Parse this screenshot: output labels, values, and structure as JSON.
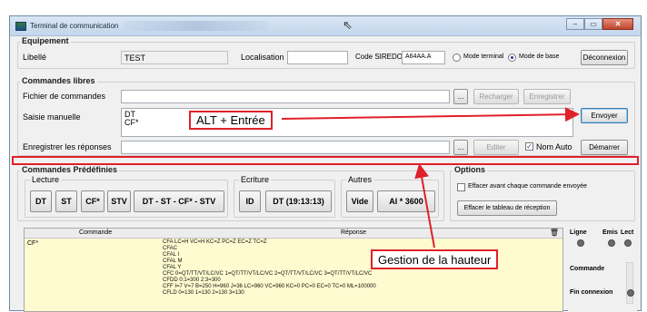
{
  "window": {
    "title": "Terminal de communication",
    "minimize": "–",
    "maximize": "▭",
    "close": "✕"
  },
  "equipement": {
    "title": "Equipement",
    "libelle_label": "Libellé",
    "libelle_value": "TEST",
    "localisation_label": "Localisation",
    "localisation_value": "",
    "code_label": "Code SIREDO",
    "code_value": "A64AA.A",
    "mode_terminal": "Mode terminal",
    "mode_base": "Mode de base",
    "selected_mode": "Mode de base",
    "deconnexion": "Déconnexion"
  },
  "commandes_libres": {
    "title": "Commandes libres",
    "fichier_label": "Fichier de commandes",
    "fichier_value": "",
    "browse": "...",
    "recharger": "Recharger",
    "enregistrer": "Enregistrer",
    "saisie_label": "Saisie manuelle",
    "saisie_line1": "DT",
    "saisie_line2": "CF*",
    "envoyer": "Envoyer",
    "reponses_label": "Enregistrer les réponses",
    "reponses_value": "",
    "editer": "Editer",
    "nom_auto": "Nom Auto",
    "nom_auto_checked": true,
    "demarrer": "Démarrer"
  },
  "predefinies": {
    "title": "Commandes Prédéfinies",
    "lecture_title": "Lecture",
    "lecture_buttons": [
      "DT",
      "ST",
      "CF*",
      "STV",
      "DT - ST - CF* - STV"
    ],
    "ecriture_title": "Ecriture",
    "ecriture_buttons": [
      "ID",
      "DT (19:13:13)"
    ],
    "autres_title": "Autres",
    "autres_buttons": [
      "Vide",
      "AI * 3600"
    ]
  },
  "options": {
    "title": "Options",
    "effacer_avant": "Effacer avant chaque commande envoyée",
    "effacer_tableau": "Effacer le tableau de réception"
  },
  "table": {
    "col_commande": "Commande",
    "col_reponse": "Réponse",
    "row_command": "CF*",
    "response_lines": [
      "CFA LC=H VC=H KC=Z PC=Z EC=Z TC=Z",
      "CFAC",
      "CFAL I",
      "CFAL M",
      "CFAL Y",
      "CFC 0=QT/TT/VT/LC/VC 1=QT/TT/VT/LC/VC 2=QT/TT/VT/LC/VC 3=QT/TT/VT/LC/VC",
      "CFDD 0:1=300 2:3=300",
      "CFF I=7 V=7 B=250 H=960 J=36 LC=960 VC=960 KC=0 PC=0 EC=0 TC=0 ML=100000",
      "CFLD 0=130 1=130 2=130 3=130"
    ]
  },
  "status": {
    "ligne": "Ligne",
    "emis": "Emis",
    "lect": "Lect",
    "commande": "Commande",
    "fin_connexion": "Fin connexion"
  },
  "annotations": {
    "alt_entree": "ALT + Entrée",
    "gestion_hauteur": "Gestion de la hauteur"
  },
  "colors": {
    "annotation_red": "#e0202a",
    "response_bg": "#fffbd0"
  }
}
